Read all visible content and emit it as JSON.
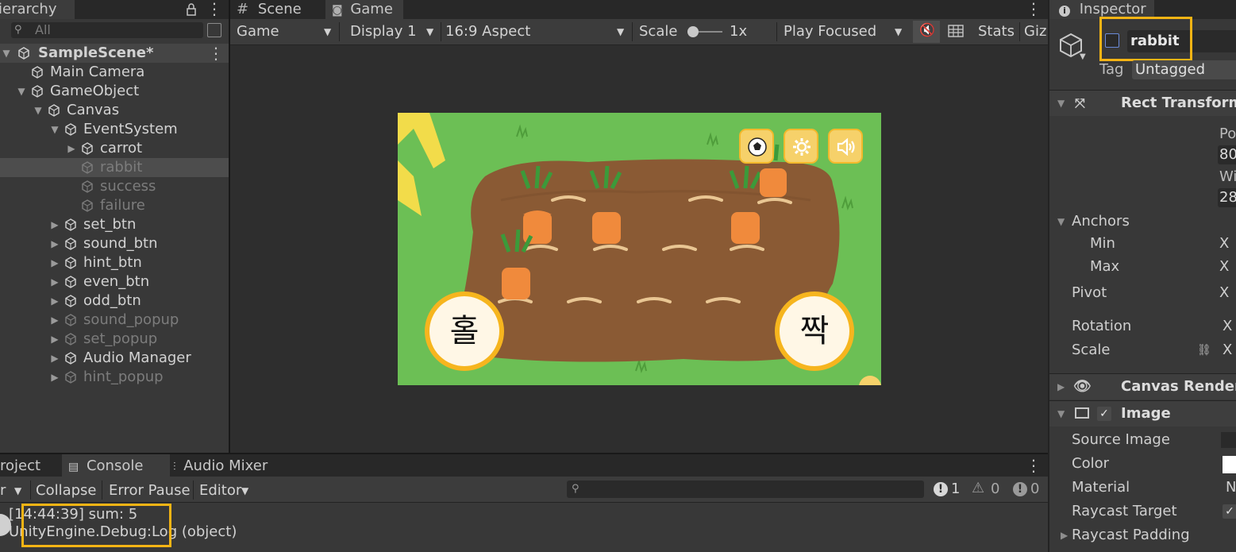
{
  "hierarchy": {
    "tab": "ierarchy",
    "search_placeholder": "All",
    "scene": "SampleScene*",
    "items": [
      {
        "label": "Main Camera"
      },
      {
        "label": "GameObject"
      },
      {
        "label": "Canvas"
      },
      {
        "label": "EventSystem"
      },
      {
        "label": "carrot"
      },
      {
        "label": "rabbit"
      },
      {
        "label": "success"
      },
      {
        "label": "failure"
      },
      {
        "label": "set_btn"
      },
      {
        "label": "sound_btn"
      },
      {
        "label": "hint_btn"
      },
      {
        "label": "even_btn"
      },
      {
        "label": "odd_btn"
      },
      {
        "label": "sound_popup"
      },
      {
        "label": "set_popup"
      },
      {
        "label": "Audio Manager"
      },
      {
        "label": "hint_popup"
      }
    ]
  },
  "center": {
    "tabs": {
      "scene": "Scene",
      "game": "Game"
    },
    "toolbar": {
      "mode": "Game",
      "display": "Display 1",
      "aspect": "16:9 Aspect",
      "scale_label": "Scale",
      "scale_value": "1x",
      "play_focused": "Play Focused",
      "stats": "Stats",
      "gizmos": "Giz"
    },
    "game": {
      "left_button": "홀",
      "right_button": "짝"
    }
  },
  "inspector": {
    "tab": "Inspector",
    "object_name": "rabbit",
    "tag_label": "Tag",
    "tag_value": "Untagged",
    "rect_transform": "Rect Transform",
    "pos_label": "Po",
    "pos_value": "80",
    "width_label": "Wi",
    "width_value": "28",
    "anchors": "Anchors",
    "min": "Min",
    "max": "Max",
    "pivot": "Pivot",
    "rotation": "Rotation",
    "scale": "Scale",
    "axis_x": "X",
    "canvas_renderer": "Canvas Rendere",
    "image": "Image",
    "source_image": "Source Image",
    "color": "Color",
    "material": "Material",
    "material_value": "N",
    "raycast_target": "Raycast Target",
    "raycast_padding": "Raycast Padding"
  },
  "console": {
    "tabs": {
      "project": "roject",
      "console": "Console",
      "audio_mixer": "Audio Mixer"
    },
    "clear_stub": "r",
    "collapse": "Collapse",
    "error_pause": "Error Pause",
    "editor": "Editor",
    "count_info": "1",
    "count_warn": "0",
    "count_error": "0",
    "log_line1": "[14:44:39] sum: 5",
    "log_line2": "UnityEngine.Debug:Log (object)"
  },
  "colors": {
    "highlight": "#f5b414",
    "grass": "#6cbf55",
    "soil": "#8a5a34",
    "carrot": "#f08a3c"
  }
}
